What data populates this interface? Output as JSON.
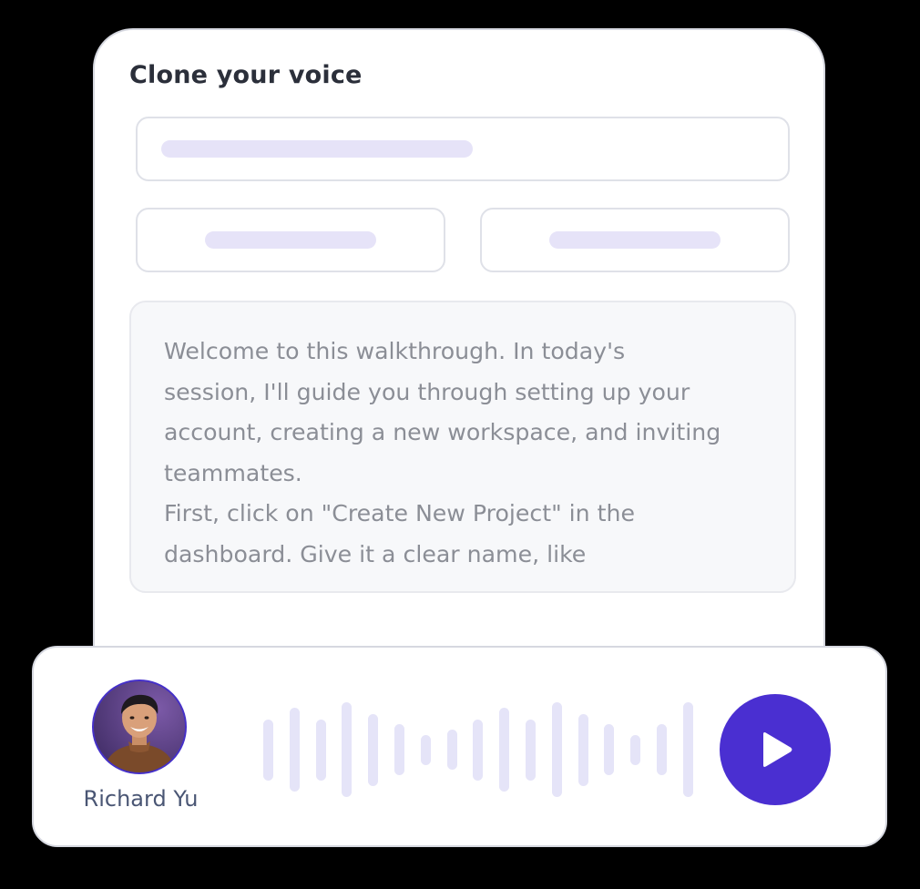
{
  "card": {
    "title": "Clone your voice"
  },
  "script": {
    "text": "Welcome to this walkthrough. In today's\nsession, I'll guide you through setting up your\naccount, creating a new workspace, and inviting\nteammates.\nFirst, click on \"Create New Project\" in the\ndashboard. Give it a clear name, like"
  },
  "player": {
    "speaker_name": "Richard Yu",
    "play_icon": "play-icon",
    "waveform_levels": [
      0.64,
      0.88,
      0.64,
      1.0,
      0.76,
      0.54,
      0.32,
      0.42,
      0.64,
      0.88,
      0.64,
      1.0,
      0.76,
      0.54,
      0.32,
      0.54,
      1.0
    ]
  },
  "colors": {
    "accent": "#4a2fd1",
    "placeholder_bar": "#e6e3f8",
    "waveform_bar": "#e5e4f8",
    "script_text": "#8b8e96",
    "speaker_text": "#4a5674"
  }
}
